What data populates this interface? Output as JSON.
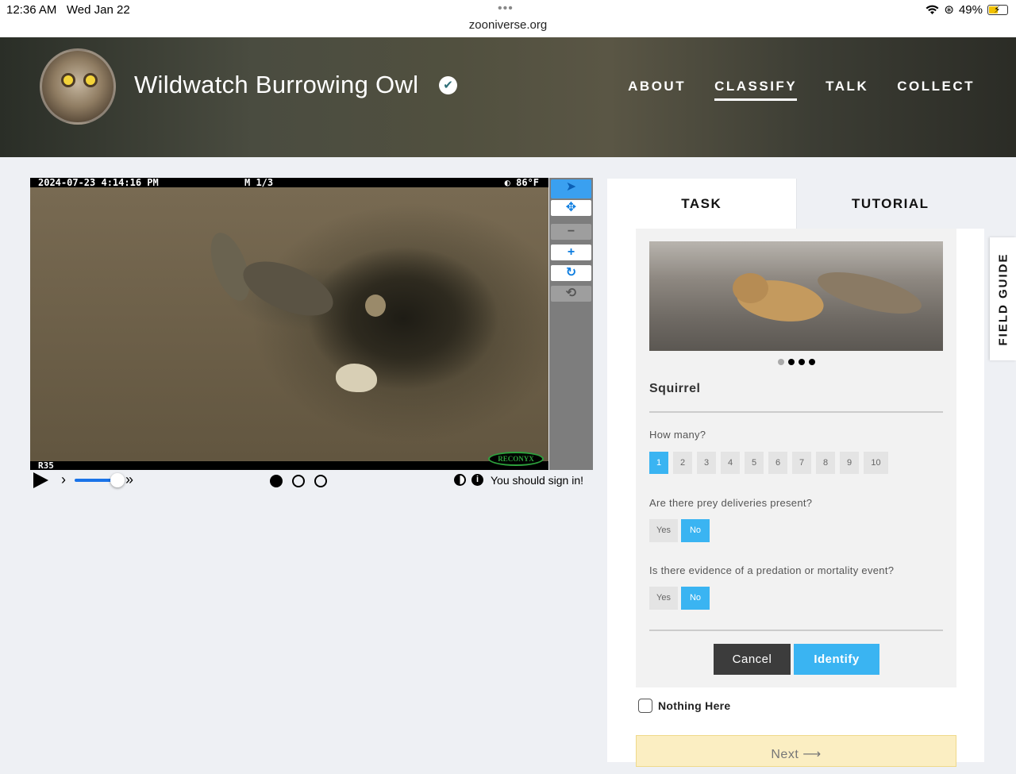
{
  "status_bar": {
    "time": "12:36 AM",
    "date": "Wed Jan 22",
    "url": "zooniverse.org",
    "battery": "49%",
    "icons": [
      "wifi-icon",
      "orientation-lock-icon",
      "battery-charging-icon"
    ]
  },
  "header": {
    "title": "Wildwatch Burrowing Owl",
    "verified_icon": "✔",
    "nav": [
      "ABOUT",
      "CLASSIFY",
      "TALK",
      "COLLECT"
    ],
    "active_nav": "CLASSIFY"
  },
  "viewer": {
    "timestamp": "2024-07-23 4:14:16 PM",
    "sequence": "M 1/3",
    "temperature": "◐ 86°F",
    "camera_id": "R35",
    "camera_brand": "RECONYX",
    "frames": 3,
    "current_frame": 1,
    "sign_in_message": "You should sign in!",
    "tools": [
      "pointer-icon",
      "move-icon",
      "zoom-out-icon",
      "zoom-in-icon",
      "rotate-icon",
      "reset-icon"
    ]
  },
  "panel": {
    "tabs": [
      "TASK",
      "TUTORIAL"
    ],
    "active_tab": "TASK",
    "species": "Squirrel",
    "how_many_label": "How many?",
    "how_many_options": [
      "1",
      "2",
      "3",
      "4",
      "5",
      "6",
      "7",
      "8",
      "9",
      "10"
    ],
    "how_many_selected": "1",
    "prey_question": "Are there prey deliveries present?",
    "prey_answer": "No",
    "predation_question": "Is there evidence of a predation or mortality event?",
    "predation_answer": "No",
    "yes_label": "Yes",
    "no_label": "No",
    "cancel_label": "Cancel",
    "identify_label": "Identify",
    "nothing_here_label": "Nothing Here",
    "next_label": "Next ⟶",
    "carousel_count": 4,
    "carousel_active": 1
  },
  "field_guide_label": "FIELD GUIDE",
  "colors": {
    "accent": "#3ab4f2",
    "next_bg": "#fbeec2",
    "cancel_bg": "#3c3c3c"
  }
}
